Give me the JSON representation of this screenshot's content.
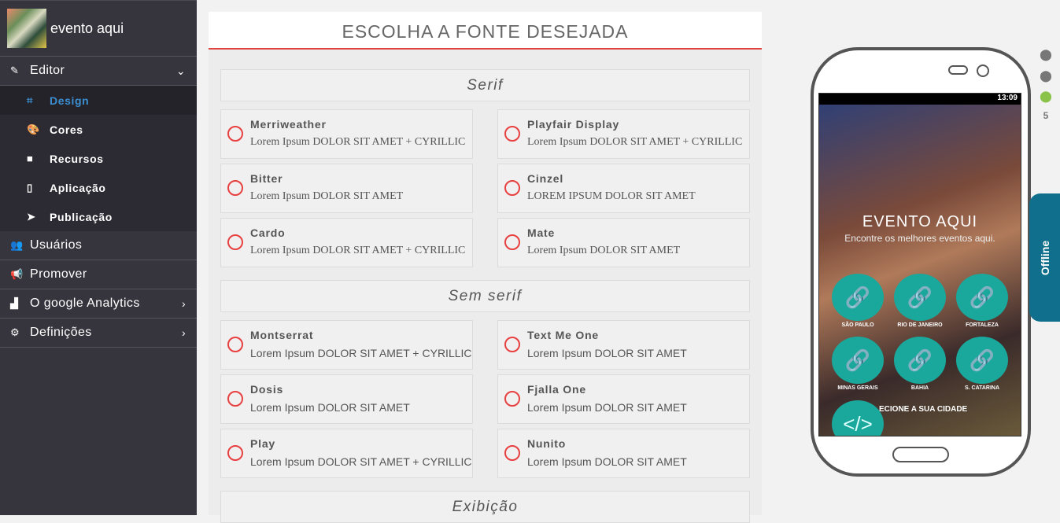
{
  "sidebar": {
    "app_name": "evento aqui",
    "editor": "Editor",
    "sub": [
      {
        "label": "Design",
        "icon": "vector-square-icon"
      },
      {
        "label": "Cores",
        "icon": "palette-icon"
      },
      {
        "label": "Recursos",
        "icon": "cube-icon"
      },
      {
        "label": "Aplicação",
        "icon": "mobile-icon"
      },
      {
        "label": "Publicação",
        "icon": "paper-plane-icon"
      }
    ],
    "items": [
      {
        "label": "Usuários",
        "icon": "users-icon"
      },
      {
        "label": "Promover",
        "icon": "bullhorn-icon"
      },
      {
        "label": "O google Analytics",
        "icon": "chart-icon"
      },
      {
        "label": "Definições",
        "icon": "cogs-icon"
      }
    ]
  },
  "main": {
    "title": "ESCOLHA A FONTE DESEJADA",
    "sections": [
      {
        "label": "Serif",
        "fonts": [
          {
            "name": "Merriweather",
            "sample": "Lorem Ipsum DOLOR SIT AMET + CYRILLIC"
          },
          {
            "name": "Playfair Display",
            "sample": "Lorem Ipsum DOLOR SIT AMET + CYRILLIC"
          },
          {
            "name": "Bitter",
            "sample": "Lorem Ipsum DOLOR SIT AMET"
          },
          {
            "name": "Cinzel",
            "sample": "LOREM IPSUM DOLOR SIT AMET"
          },
          {
            "name": "Cardo",
            "sample": "Lorem Ipsum DOLOR SIT AMET + CYRILLIC"
          },
          {
            "name": "Mate",
            "sample": "Lorem Ipsum DOLOR SIT AMET"
          }
        ]
      },
      {
        "label": "Sem serif",
        "fonts": [
          {
            "name": "Montserrat",
            "sample": "Lorem Ipsum DOLOR SIT AMET + CYRILLIC"
          },
          {
            "name": "Text Me One",
            "sample": "Lorem  Ipsum  DOLOR  SIT  AMET"
          },
          {
            "name": "Dosis",
            "sample": "Lorem Ipsum DOLOR SIT AMET"
          },
          {
            "name": "Fjalla One",
            "sample": "Lorem Ipsum DOLOR SIT AMET"
          },
          {
            "name": "Play",
            "sample": "Lorem Ipsum DOLOR SIT AMET + CYRILLIC"
          },
          {
            "name": "Nunito",
            "sample": "Lorem Ipsum DOLOR SIT AMET"
          }
        ]
      },
      {
        "label": "Exibição",
        "fonts": []
      }
    ]
  },
  "preview": {
    "time": "13:09",
    "title": "EVENTO AQUI",
    "subtitle": "Encontre os melhores eventos aqui.",
    "cities": [
      "SÃO PAULO",
      "RIO DE JANEIRO",
      "FORTALEZA",
      "MINAS GERAIS",
      "BAHIA",
      "S. CATARINA"
    ],
    "select_text": "ECIONE A SUA CIDADE",
    "offline": "Offline",
    "platforms": [
      "ios5-icon",
      "ios6-icon",
      "android-icon",
      "html5-icon"
    ]
  },
  "colors": {
    "accent": "#e0463f",
    "active": "#3b8ed0",
    "teal": "#1aa89c",
    "offline": "#0f6f8c"
  }
}
